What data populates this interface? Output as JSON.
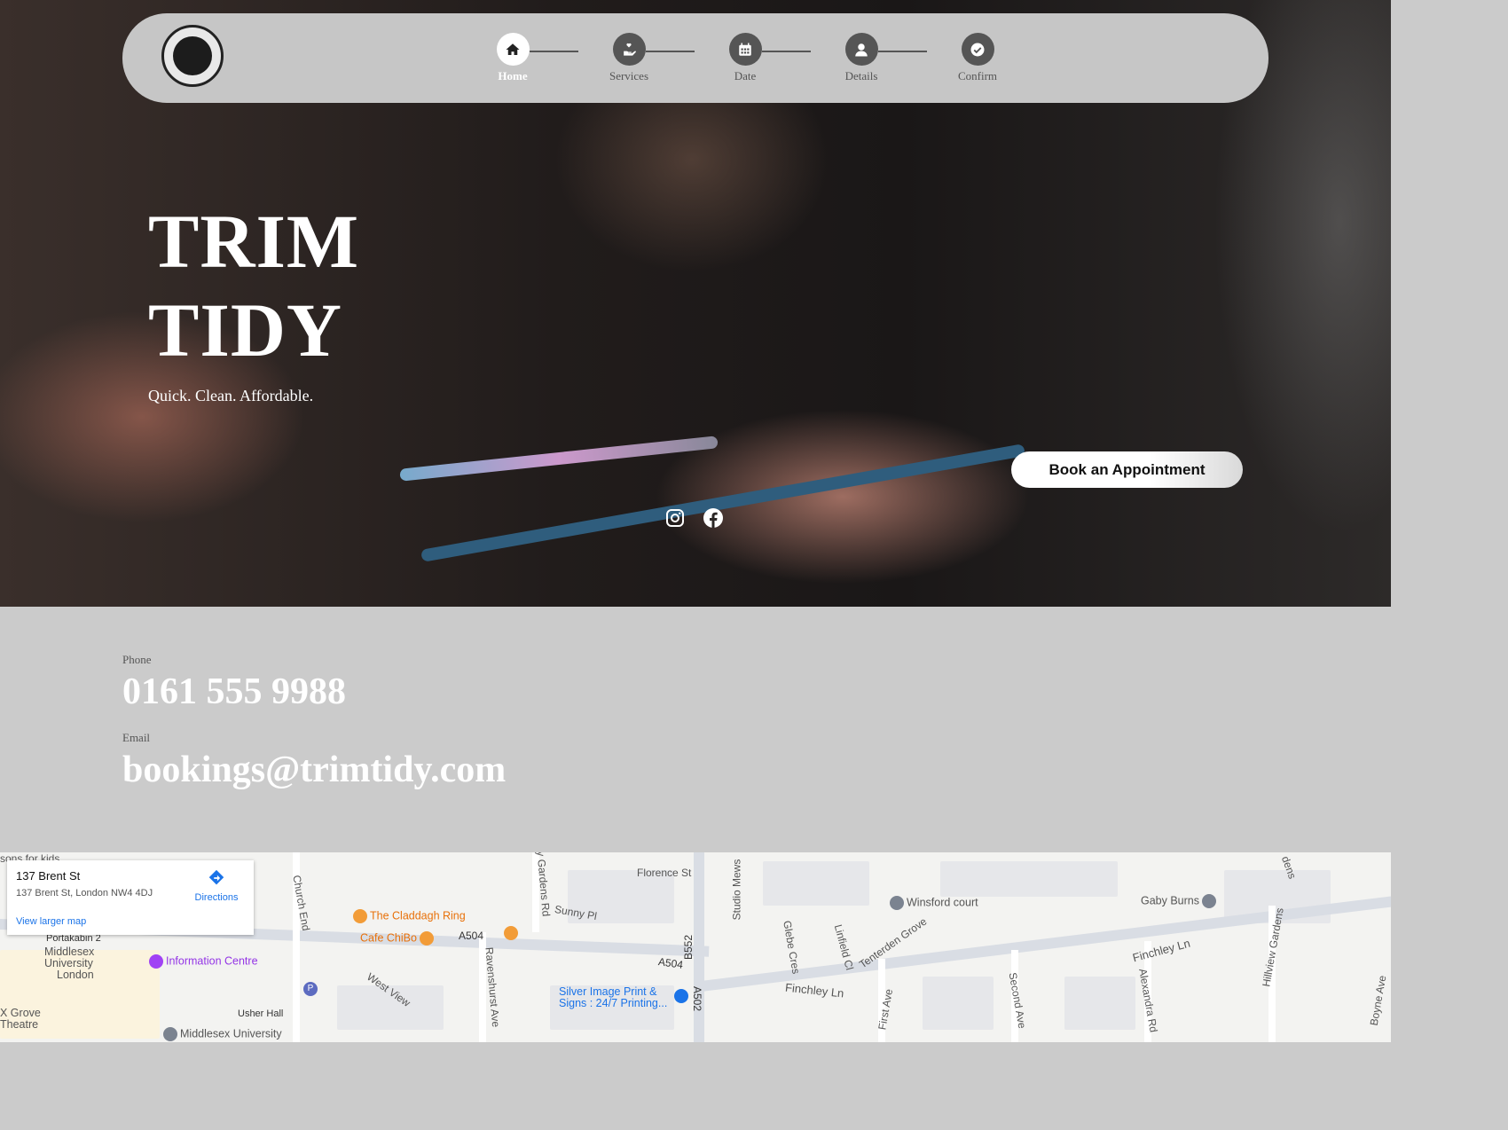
{
  "nav": {
    "steps": [
      {
        "label": "Home",
        "icon": "home-icon"
      },
      {
        "label": "Services",
        "icon": "service-hand-icon"
      },
      {
        "label": "Date",
        "icon": "calendar-icon"
      },
      {
        "label": "Details",
        "icon": "user-icon"
      },
      {
        "label": "Confirm",
        "icon": "check-icon"
      }
    ]
  },
  "hero": {
    "title_line1": "TRIM",
    "title_line2": "TIDY",
    "tagline": "Quick. Clean. Affordable.",
    "book_button": "Book an Appointment",
    "social": [
      "instagram-icon",
      "facebook-icon"
    ]
  },
  "contact": {
    "phone_label": "Phone",
    "phone": "0161 555 9988",
    "email_label": "Email",
    "email": "bookings@trimtidy.com"
  },
  "map": {
    "infobox": {
      "title": "137 Brent St",
      "address": "137 Brent St, London NW4 4DJ",
      "directions": "Directions",
      "larger_map": "View larger map"
    },
    "labels": {
      "florence": "Florence St",
      "sunny": "Sunny Pl",
      "claddagh": "The Claddagh Ring",
      "cafe": "Cafe ChiBo",
      "a504a": "A504",
      "a504b": "A504",
      "b552": "B552",
      "a502": "A502",
      "studio": "Studio Mews",
      "glebe": "Glebe Cres",
      "linfield": "Linfield Cl",
      "tenterden": "Tenterden Grove",
      "winsford": "Winsford court",
      "gaby": "Gaby Burns",
      "finchley1": "Finchley Ln",
      "finchley2": "Finchley Ln",
      "first": "First Ave",
      "second": "Second Ave",
      "alexandra": "Alexandra Rd",
      "hillview": "Hillview Gardens",
      "silver1": "Silver Image Print &",
      "silver2": "Signs : 24/7 Printing...",
      "church": "Church End",
      "ravenshurst": "Ravenshurst Ave",
      "westview": "West View",
      "portakabin": "Portakabin 2",
      "middlesex1": "Middlesex",
      "middlesex2": "University",
      "middlesex3": "London",
      "infocentre": "Information Centre",
      "usher": "Usher Hall",
      "middlesexU": "Middlesex University",
      "kgrove": "X Grove",
      "theatre": "Theatre",
      "kids": "sons for kids",
      "gardens": "ny Gardens Rd",
      "boyne": "Boyne Ave",
      "dens": "dens"
    }
  }
}
